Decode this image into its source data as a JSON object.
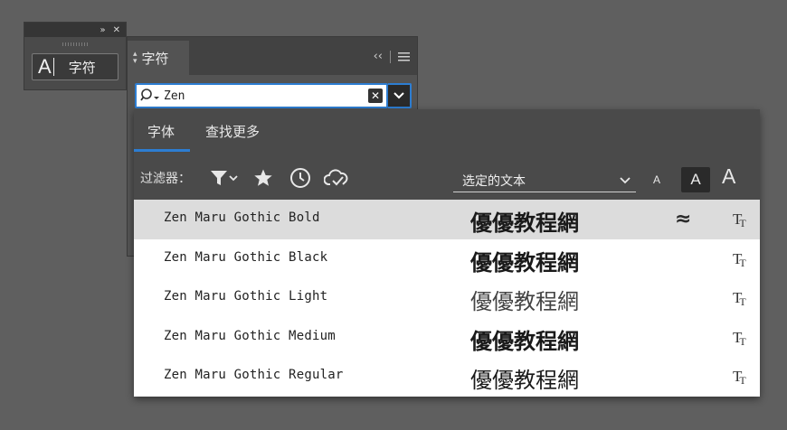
{
  "mini_panel": {
    "icon": "text-cursor-icon",
    "label": "字符",
    "controls": [
      "»",
      "✕"
    ]
  },
  "panel": {
    "tab_title": "字符",
    "collapse_label": "‹‹",
    "search": {
      "value": "Zen"
    }
  },
  "font_popup": {
    "tabs": [
      "字体",
      "查找更多"
    ],
    "active_tab": "字体",
    "filter_label": "过滤器：",
    "filter_icons": [
      "filter-icon",
      "star-icon",
      "clock-icon",
      "cloud-icon"
    ],
    "preview_select": "选定的文本",
    "size_buttons": [
      "A",
      "A",
      "A"
    ],
    "fonts": [
      {
        "name": "Zen Maru Gothic Bold",
        "sample": "優優教程網",
        "weight": "bold",
        "similar": "≈",
        "type_icon": "truetype-icon",
        "highlighted": true
      },
      {
        "name": "Zen Maru Gothic Black",
        "sample": "優優教程網",
        "weight": "black",
        "similar": "",
        "type_icon": "truetype-icon",
        "highlighted": false
      },
      {
        "name": "Zen Maru Gothic Light",
        "sample": "優優教程網",
        "weight": "light",
        "similar": "",
        "type_icon": "truetype-icon",
        "highlighted": false
      },
      {
        "name": "Zen Maru Gothic Medium",
        "sample": "優優教程網",
        "weight": "medium",
        "similar": "",
        "type_icon": "truetype-icon",
        "highlighted": false
      },
      {
        "name": "Zen Maru Gothic Regular",
        "sample": "優優教程網",
        "weight": "regular",
        "similar": "",
        "type_icon": "truetype-icon",
        "highlighted": false
      }
    ]
  },
  "colors": {
    "accent": "#2d7dd2",
    "panel_bg": "#535353",
    "workspace_bg": "#5f5f5f",
    "highlight_row": "#dcdcdc"
  }
}
